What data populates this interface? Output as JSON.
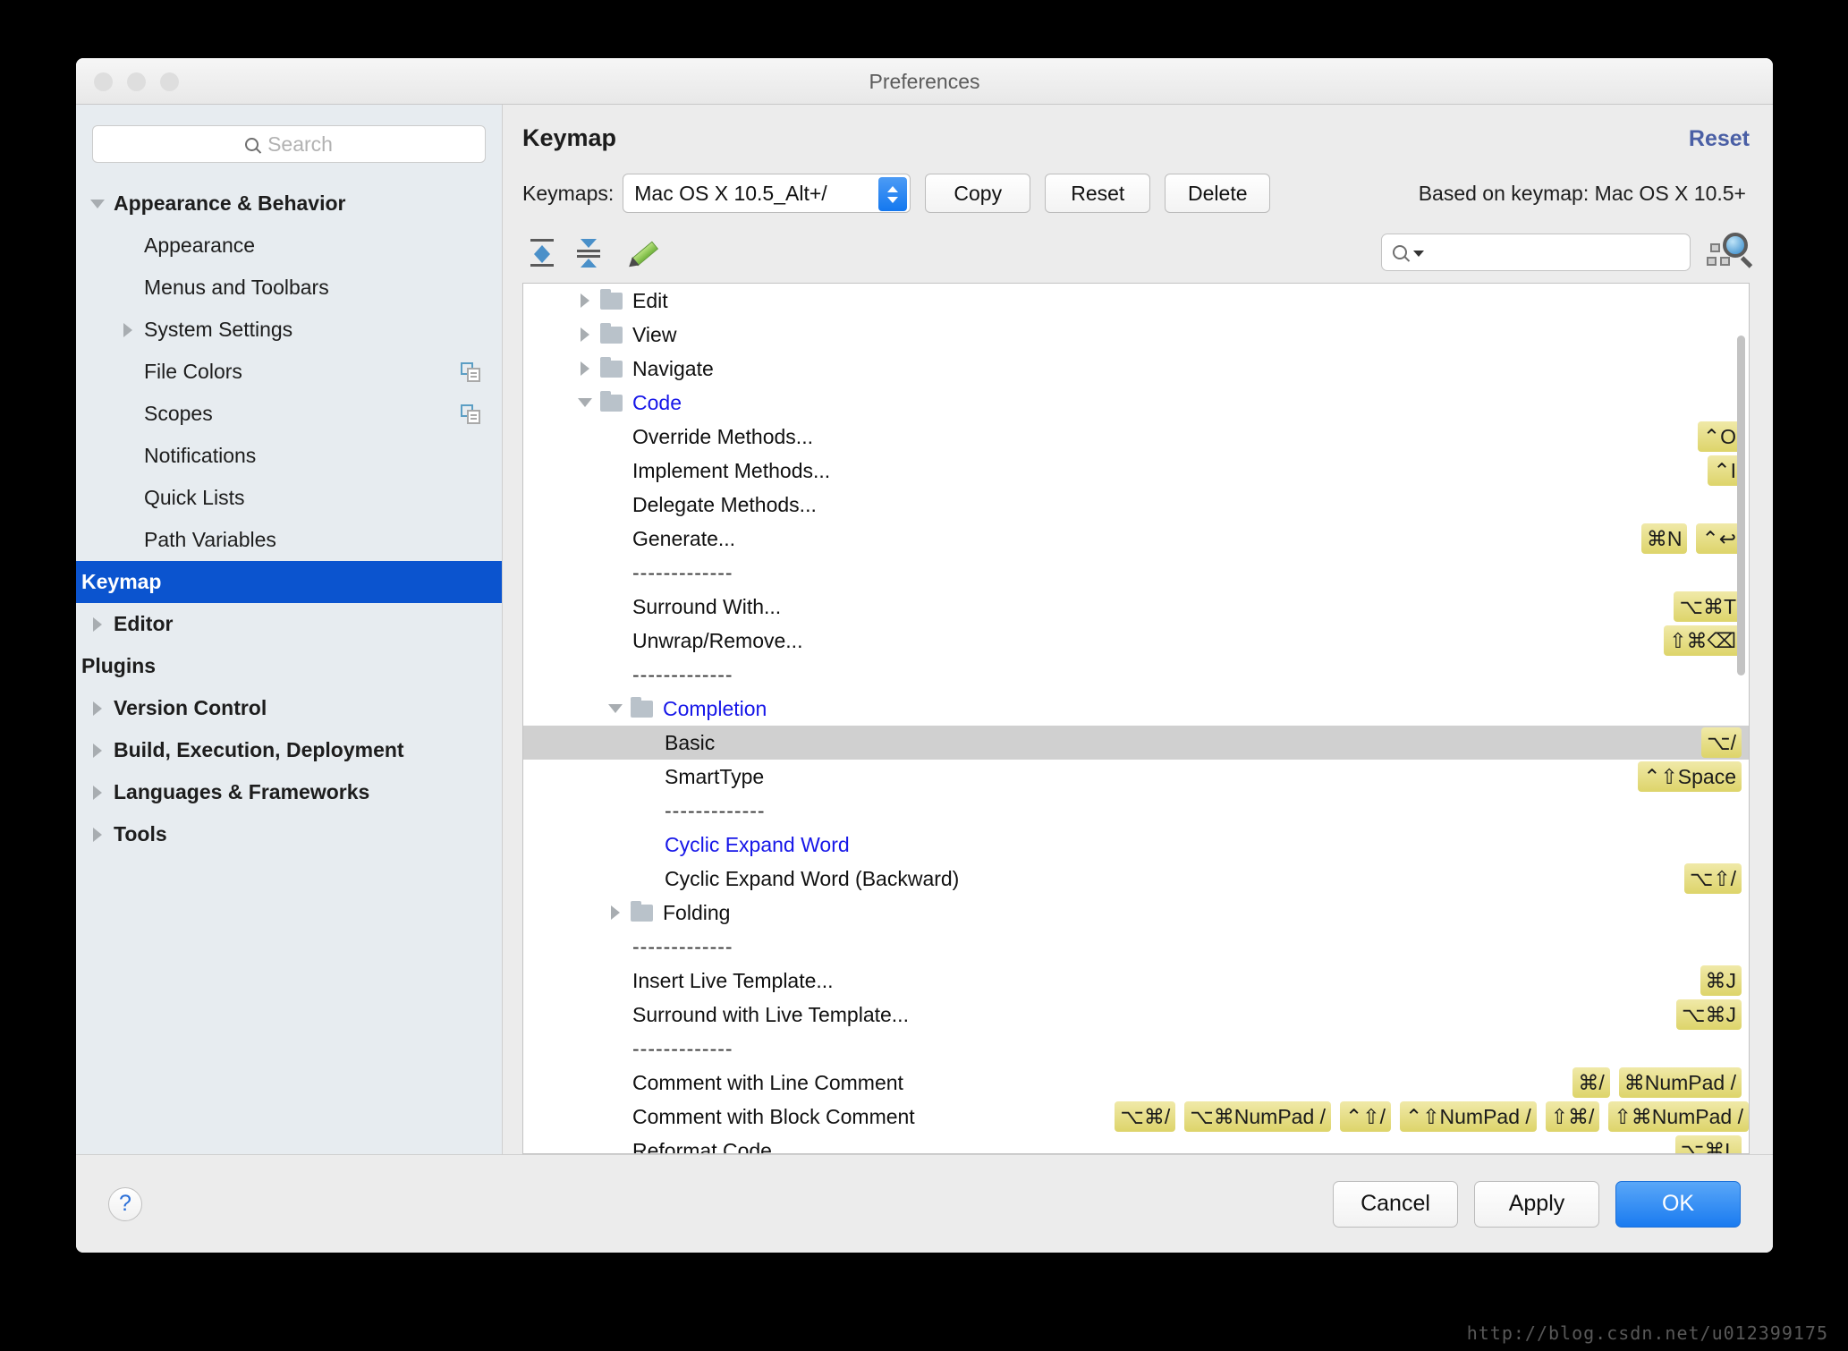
{
  "window": {
    "title": "Preferences"
  },
  "sidebar": {
    "search_placeholder": "Search",
    "items": [
      {
        "label": "Appearance & Behavior",
        "level": 0,
        "twisty": "down",
        "bold": true,
        "selected": false,
        "copy": false
      },
      {
        "label": "Appearance",
        "level": 1,
        "twisty": "none",
        "bold": false,
        "selected": false,
        "copy": false
      },
      {
        "label": "Menus and Toolbars",
        "level": 1,
        "twisty": "none",
        "bold": false,
        "selected": false,
        "copy": false
      },
      {
        "label": "System Settings",
        "level": 1,
        "twisty": "right",
        "bold": false,
        "selected": false,
        "copy": false
      },
      {
        "label": "File Colors",
        "level": 1,
        "twisty": "none",
        "bold": false,
        "selected": false,
        "copy": true
      },
      {
        "label": "Scopes",
        "level": 1,
        "twisty": "none",
        "bold": false,
        "selected": false,
        "copy": true
      },
      {
        "label": "Notifications",
        "level": 1,
        "twisty": "none",
        "bold": false,
        "selected": false,
        "copy": false
      },
      {
        "label": "Quick Lists",
        "level": 1,
        "twisty": "none",
        "bold": false,
        "selected": false,
        "copy": false
      },
      {
        "label": "Path Variables",
        "level": 1,
        "twisty": "none",
        "bold": false,
        "selected": false,
        "copy": false
      },
      {
        "label": "Keymap",
        "level": 0,
        "twisty": "none",
        "bold": true,
        "selected": true,
        "copy": false
      },
      {
        "label": "Editor",
        "level": 0,
        "twisty": "right",
        "bold": true,
        "selected": false,
        "copy": false
      },
      {
        "label": "Plugins",
        "level": 0,
        "twisty": "none",
        "bold": true,
        "selected": false,
        "copy": false
      },
      {
        "label": "Version Control",
        "level": 0,
        "twisty": "right",
        "bold": true,
        "selected": false,
        "copy": false
      },
      {
        "label": "Build, Execution, Deployment",
        "level": 0,
        "twisty": "right",
        "bold": true,
        "selected": false,
        "copy": false
      },
      {
        "label": "Languages & Frameworks",
        "level": 0,
        "twisty": "right",
        "bold": true,
        "selected": false,
        "copy": false
      },
      {
        "label": "Tools",
        "level": 0,
        "twisty": "right",
        "bold": true,
        "selected": false,
        "copy": false
      }
    ]
  },
  "main": {
    "page_title": "Keymap",
    "reset_link": "Reset",
    "keymaps_label": "Keymaps:",
    "keymap_selected": "Mac OS X 10.5_Alt+/",
    "buttons": {
      "copy": "Copy",
      "reset": "Reset",
      "delete": "Delete"
    },
    "based_on": "Based on keymap: Mac OS X 10.5+",
    "toolbar": {
      "expand_all": "expand-all-icon",
      "collapse_all": "collapse-all-icon",
      "edit": "pencil-icon",
      "search_value": "",
      "find_actions": "find-actions-icon"
    }
  },
  "tree": {
    "rows": [
      {
        "kind": "folder",
        "label": "Edit",
        "indent": 0,
        "twisty": "right",
        "blue": false,
        "keys": []
      },
      {
        "kind": "folder",
        "label": "View",
        "indent": 0,
        "twisty": "right",
        "blue": false,
        "keys": []
      },
      {
        "kind": "folder",
        "label": "Navigate",
        "indent": 0,
        "twisty": "right",
        "blue": false,
        "keys": []
      },
      {
        "kind": "folder",
        "label": "Code",
        "indent": 0,
        "twisty": "down",
        "blue": true,
        "keys": []
      },
      {
        "kind": "action",
        "label": "Override Methods...",
        "indent": 1,
        "blue": false,
        "keys": [
          "⌃O"
        ]
      },
      {
        "kind": "action",
        "label": "Implement Methods...",
        "indent": 1,
        "blue": false,
        "keys": [
          "⌃I"
        ]
      },
      {
        "kind": "action",
        "label": "Delegate Methods...",
        "indent": 1,
        "blue": false,
        "keys": []
      },
      {
        "kind": "action",
        "label": "Generate...",
        "indent": 1,
        "blue": false,
        "keys": [
          "⌘N",
          "⌃↩"
        ]
      },
      {
        "kind": "sep",
        "label": "-------------",
        "indent": 1,
        "blue": false,
        "keys": []
      },
      {
        "kind": "action",
        "label": "Surround With...",
        "indent": 1,
        "blue": false,
        "keys": [
          "⌥⌘T"
        ]
      },
      {
        "kind": "action",
        "label": "Unwrap/Remove...",
        "indent": 1,
        "blue": false,
        "keys": [
          "⇧⌘⌫"
        ]
      },
      {
        "kind": "sep",
        "label": "-------------",
        "indent": 1,
        "blue": false,
        "keys": []
      },
      {
        "kind": "folder",
        "label": "Completion",
        "indent": 1,
        "twisty": "down",
        "blue": true,
        "keys": []
      },
      {
        "kind": "action",
        "label": "Basic",
        "indent": 2,
        "blue": false,
        "selected": true,
        "keys": [
          "⌥/"
        ]
      },
      {
        "kind": "action",
        "label": "SmartType",
        "indent": 2,
        "blue": false,
        "keys": [
          "⌃⇧Space"
        ]
      },
      {
        "kind": "sep",
        "label": "-------------",
        "indent": 2,
        "blue": false,
        "keys": []
      },
      {
        "kind": "action",
        "label": "Cyclic Expand Word",
        "indent": 2,
        "blue": true,
        "keys": []
      },
      {
        "kind": "action",
        "label": "Cyclic Expand Word (Backward)",
        "indent": 2,
        "blue": false,
        "keys": [
          "⌥⇧/"
        ]
      },
      {
        "kind": "folder",
        "label": "Folding",
        "indent": 1,
        "twisty": "right",
        "blue": false,
        "keys": []
      },
      {
        "kind": "sep",
        "label": "-------------",
        "indent": 1,
        "blue": false,
        "keys": []
      },
      {
        "kind": "action",
        "label": "Insert Live Template...",
        "indent": 1,
        "blue": false,
        "keys": [
          "⌘J"
        ]
      },
      {
        "kind": "action",
        "label": "Surround with Live Template...",
        "indent": 1,
        "blue": false,
        "keys": [
          "⌥⌘J"
        ]
      },
      {
        "kind": "sep",
        "label": "-------------",
        "indent": 1,
        "blue": false,
        "keys": []
      },
      {
        "kind": "action",
        "label": "Comment with Line Comment",
        "indent": 1,
        "blue": false,
        "keys": [
          "⌘/",
          "⌘NumPad /"
        ]
      },
      {
        "kind": "action",
        "label": "Comment with Block Comment",
        "indent": 1,
        "blue": false,
        "inlineKeys": true,
        "keys": [
          "⌥⌘/",
          "⌥⌘NumPad /",
          "⌃⇧/",
          "⌃⇧NumPad /",
          "⇧⌘/",
          "⇧⌘NumPad /"
        ]
      },
      {
        "kind": "action",
        "label": "Reformat Code",
        "indent": 1,
        "blue": false,
        "keys": [
          "⌥⌘L"
        ]
      }
    ]
  },
  "footer": {
    "help": "?",
    "cancel": "Cancel",
    "apply": "Apply",
    "ok": "OK"
  },
  "watermark": "http://blog.csdn.net/u012399175"
}
